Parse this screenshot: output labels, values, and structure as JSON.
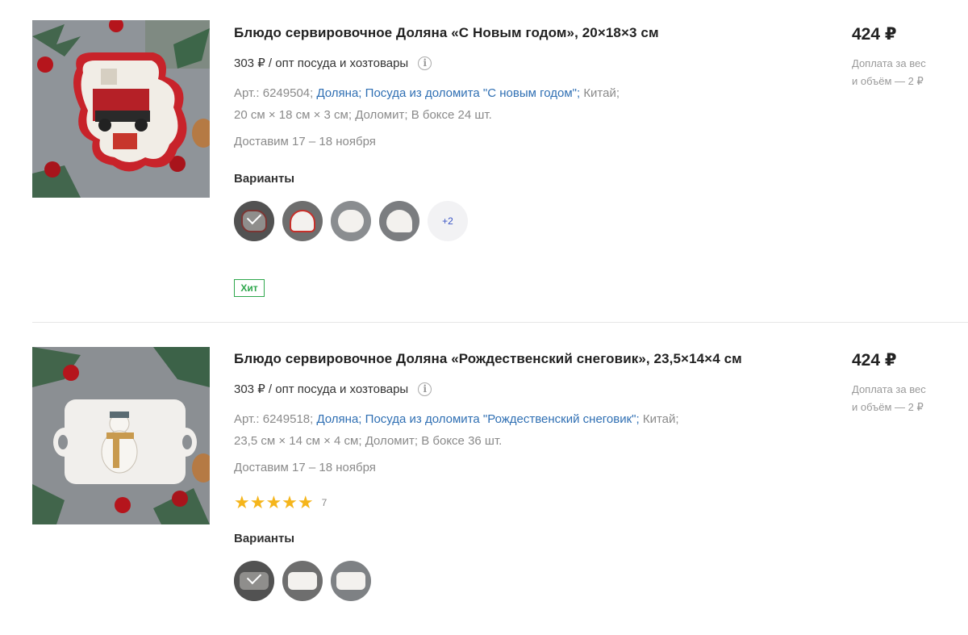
{
  "products": [
    {
      "title": "Блюдо сервировочное Доляна «С Новым годом», 20×18×3 см",
      "wholesale_price": "303 ₽ / опт посуда и хозтовары",
      "info_icon": "i",
      "sku_label": "Арт.: 6249504;",
      "brand_link": "Доляна;",
      "collection_link": "Посуда из доломита \"С новым годом\";",
      "country": "Китай;",
      "size": "20 см × 18 см × 3 см;",
      "material": "Доломит;",
      "box": "В боксе 24 шт.",
      "delivery": "Доставим 17 – 18 ноября",
      "variants_label": "Варианты",
      "more_variants": "+2",
      "badge": "Хит",
      "price": "424 ₽",
      "surcharge_line1": "Доплата за вес",
      "surcharge_line2": "и объём — 2 ₽"
    },
    {
      "title": "Блюдо сервировочное Доляна «Рождественский снеговик», 23,5×14×4 см",
      "wholesale_price": "303 ₽ / опт посуда и хозтовары",
      "info_icon": "i",
      "sku_label": "Арт.: 6249518;",
      "brand_link": "Доляна;",
      "collection_link": "Посуда из доломита \"Рождественский снеговик\";",
      "country": "Китай;",
      "size": "23,5 см × 14 см × 4 см;",
      "material": "Доломит;",
      "box": "В боксе 36 шт.",
      "delivery": "Доставим 17 – 18 ноября",
      "rating_value": 5,
      "rating_stars": "★★★★★",
      "rating_count": "7",
      "variants_label": "Варианты",
      "price": "424 ₽",
      "surcharge_line1": "Доплата за вес",
      "surcharge_line2": "и объём — 2 ₽"
    }
  ],
  "colors": {
    "link": "#2f6fb3",
    "badge_green": "#2ea74c",
    "star": "#f5b51b",
    "more_text": "#3a55c6"
  }
}
